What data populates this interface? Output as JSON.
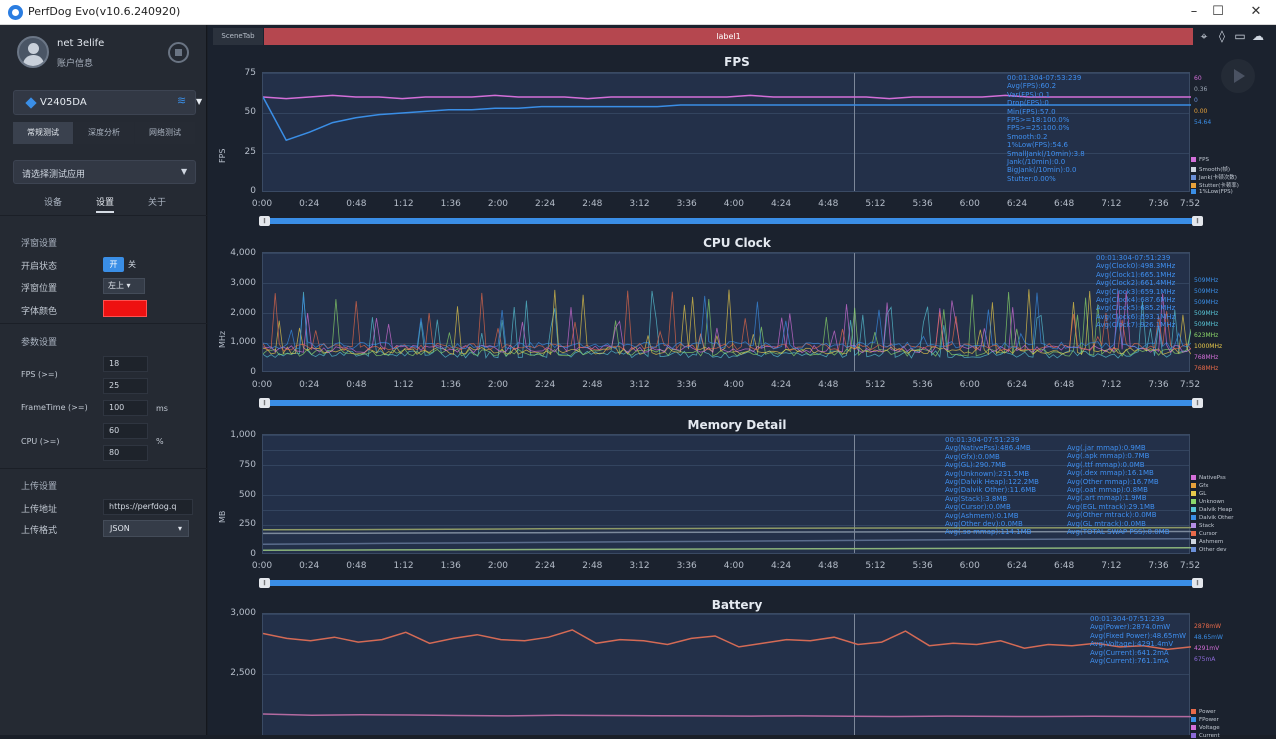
{
  "window": {
    "title": "PerfDog Evo(v10.6.240920)",
    "controls": [
      "–",
      "☐",
      "✕"
    ]
  },
  "sidebar": {
    "user_name": "net 3elife",
    "user_info": "账户信息",
    "device": "V2405DA",
    "mode_tabs": [
      "常规测试",
      "深度分析",
      "网络测试"
    ],
    "app_select_placeholder": "请选择测试应用",
    "sub_tabs": [
      "设备",
      "设置",
      "关于"
    ],
    "float_section": "浮窗设置",
    "float_state_label": "开启状态",
    "float_on": "开",
    "float_off": "关",
    "float_pos_label": "浮窗位置",
    "float_pos_value": "左上",
    "font_color_label": "字体颜色",
    "font_color": "#ee1111",
    "param_section": "参数设置",
    "fps_label": "FPS (>=)",
    "fps_values": [
      "18",
      "25"
    ],
    "frametime_label": "FrameTime (>=)",
    "frametime_value": "100",
    "frametime_unit": "ms",
    "cpu_label": "CPU (>=)",
    "cpu_values": [
      "60",
      "80"
    ],
    "cpu_unit": "%",
    "upload_section": "上传设置",
    "upload_addr_label": "上传地址",
    "upload_addr_value": "https://perfdog.q",
    "upload_fmt_label": "上传格式",
    "upload_fmt_value": "JSON"
  },
  "main": {
    "scene_tab": "SceneTab",
    "label_bar": "label1",
    "x_ticks": [
      "0:00",
      "0:24",
      "0:48",
      "1:12",
      "1:36",
      "2:00",
      "2:24",
      "2:48",
      "3:12",
      "3:36",
      "4:00",
      "4:24",
      "4:48",
      "5:12",
      "5:36",
      "6:00",
      "6:24",
      "6:48",
      "7:12",
      "7:36",
      "7:52"
    ]
  },
  "chart_data": [
    {
      "type": "line",
      "title": "FPS",
      "ylabel": "FPS",
      "ylim": [
        0,
        75
      ],
      "yticks": [
        "75",
        "50",
        "25",
        "0"
      ],
      "cursor_time": "5:00",
      "info": [
        "00:01:304-07:53:239",
        "Avg(FPS):60.2",
        "Var(FPS):0.1",
        "Drop(FPS):0",
        "Min(FPS):57.0",
        "FPS>=18:100.0%",
        "FPS>=25:100.0%",
        "Smooth:0.2",
        "1%Low(FPS):54.6",
        "SmallJank(/10min):3.8",
        "Jank(/10min):0.0",
        "BigJank(/10min):0.0",
        "Stutter:0.00%"
      ],
      "legend": [
        "FPS",
        "Smooth(帧)",
        "Jank(卡顿次数)",
        "Stutter(卡顿率)",
        "1%Low(FPS)"
      ],
      "legend_colors": [
        "#d46fd9",
        "#cfd6e0",
        "#6a8fd8",
        "#e8a23a",
        "#3a8ee6"
      ],
      "right_values": [
        "60",
        "0.36",
        "0",
        "0.00",
        "54.64"
      ],
      "right_colors": [
        "#d46fd9",
        "#9aa5b3",
        "#6a8fd8",
        "#e8a23a",
        "#3a8ee6"
      ],
      "series": [
        {
          "name": "FPS",
          "color": "#d46fd9",
          "values": [
            60,
            59,
            60,
            61,
            60,
            60,
            59,
            60,
            60,
            60,
            61,
            60,
            60,
            60,
            59,
            60,
            60,
            60,
            60,
            60,
            60,
            61,
            60,
            60,
            60,
            60,
            60,
            59,
            60,
            60,
            60,
            60,
            61,
            60,
            60,
            60,
            60,
            60,
            60,
            60,
            60
          ]
        },
        {
          "name": "1%Low(FPS)",
          "color": "#3a8ee6",
          "values": [
            60,
            33,
            38,
            44,
            47,
            49,
            50,
            51,
            52,
            52,
            53,
            53,
            54,
            54,
            54,
            54,
            54,
            54,
            55,
            55,
            55,
            55,
            55,
            55,
            55,
            55,
            55,
            55,
            55,
            55,
            55,
            55,
            55,
            55,
            55,
            55,
            55,
            55,
            55,
            55,
            55
          ]
        }
      ]
    },
    {
      "type": "line",
      "title": "CPU Clock",
      "ylabel": "MHz",
      "ylim": [
        0,
        4000
      ],
      "yticks": [
        "4,000",
        "3,000",
        "2,000",
        "1,000",
        "0"
      ],
      "info": [
        "00:01:304-07:51:239",
        "Avg(Clock0):498.3MHz",
        "Avg(Clock1):665.1MHz",
        "Avg(Clock2):661.4MHz",
        "Avg(Clock3):659.1MHz",
        "Avg(Clock4):687.6MHz",
        "Avg(Clock5):685.2MHz",
        "Avg(Clock6):693.1MHz",
        "Avg(Clock7):926.1MHz"
      ],
      "right_values": [
        "509MHz",
        "509MHz",
        "509MHz",
        "509MHz",
        "509MHz",
        "623MHz",
        "1000MHz",
        "768MHz",
        "768MHz"
      ],
      "right_colors": [
        "#3a8ee6",
        "#3a8ee6",
        "#3a8ee6",
        "#58c4d6",
        "#58c4d6",
        "#8cd76a",
        "#e8c94a",
        "#d46fd9",
        "#e86a4a"
      ]
    },
    {
      "type": "line",
      "title": "Memory Detail",
      "ylabel": "MB",
      "ylim": [
        0,
        1000
      ],
      "yticks": [
        "1,000",
        "750",
        "500",
        "250",
        "0"
      ],
      "info_left": [
        "00:01:304-07:51:239",
        "Avg(NativePss):486.4MB",
        "Avg(Gfx):0.0MB",
        "Avg(GL):290.7MB",
        "Avg(Unknown):231.5MB",
        "Avg(Dalvik Heap):122.2MB",
        "Avg(Dalvik Other):11.6MB",
        "Avg(Stack):3.8MB",
        "Avg(Cursor):0.0MB",
        "Avg(Ashmem):0.1MB",
        "Avg(Other dev):0.0MB",
        "Avg(.so mmap):114.1MB"
      ],
      "info_right": [
        "Avg(.jar mmap):0.9MB",
        "Avg(.apk mmap):0.7MB",
        "Avg(.ttf mmap):0.0MB",
        "Avg(.dex mmap):16.1MB",
        "Avg(Other mmap):16.7MB",
        "Avg(.oat mmap):0.8MB",
        "Avg(.art mmap):1.9MB",
        "Avg(EGL mtrack):29.1MB",
        "Avg(Other mtrack):0.0MB",
        "Avg(GL mtrack):0.0MB",
        "Avg(TOTAL SWAP PSS):0.0MB"
      ],
      "legend": [
        "NativePss",
        "Gfx",
        "GL",
        "Unknown",
        "Dalvik Heap",
        "Dalvik Other",
        "Stack",
        "Cursor",
        "Ashmem",
        "Other dev"
      ],
      "legend_colors": [
        "#d46fd9",
        "#e8a23a",
        "#e8c94a",
        "#8cd76a",
        "#58c4d6",
        "#3a8ee6",
        "#b48de6",
        "#e86a4a",
        "#cfd6e0",
        "#6a8fd8"
      ],
      "series": [
        {
          "name": "NativePss",
          "color": "#8e9a66",
          "values": [
            210,
            212,
            215,
            218,
            220,
            222,
            224,
            225,
            226,
            227,
            228
          ]
        },
        {
          "name": "GL",
          "color": "#7c8a9c",
          "values": [
            180,
            182,
            184,
            186,
            188,
            190,
            192,
            193,
            194,
            195,
            196
          ]
        },
        {
          "name": "Unknown",
          "color": "#5a6c8c",
          "values": [
            90,
            95,
            100,
            105,
            110,
            115,
            120,
            125,
            130,
            133,
            135
          ]
        },
        {
          "name": "Dalvik Heap",
          "color": "#8bb37a",
          "values": [
            40,
            42,
            44,
            46,
            48,
            50,
            52,
            54,
            56,
            58,
            60
          ]
        }
      ]
    },
    {
      "type": "line",
      "title": "Battery",
      "ylim": [
        2000,
        3000
      ],
      "yticks": [
        "3,000",
        "2,500"
      ],
      "info": [
        "00:01:304-07:51:239",
        "Avg(Power):2874.0mW",
        "Avg(Fixed Power):48.65mW",
        "Avg(Voltage):4291.4mV",
        "Avg(Current):641.2mA",
        "Avg(Current):761.1mA"
      ],
      "legend": [
        "Power",
        "FPower",
        "Voltage",
        "Current"
      ],
      "legend_colors": [
        "#e86a4a",
        "#3a8ee6",
        "#d46fd9",
        "#8c6ad8"
      ],
      "right_values": [
        "2878mW",
        "48.65mW",
        "4291mV",
        "675mA"
      ],
      "right_colors": [
        "#e86a4a",
        "#3a8ee6",
        "#d46fd9",
        "#8c6ad8"
      ],
      "series": [
        {
          "name": "Power",
          "color": "#d46a55",
          "values": [
            2840,
            2800,
            2780,
            2810,
            2770,
            2790,
            2850,
            2760,
            2800,
            2830,
            2790,
            2780,
            2810,
            2870,
            2760,
            2790,
            2780,
            2750,
            2800,
            2820,
            2730,
            2760,
            2790,
            2780,
            2810,
            2750,
            2770,
            2860,
            2740,
            2760,
            2750,
            2780,
            2720,
            2750,
            2740,
            2760,
            2730,
            2740,
            2710,
            2730
          ]
        },
        {
          "name": "Current",
          "color": "#b46aa0",
          "values": [
            2180,
            2170,
            2175,
            2172,
            2168,
            2165,
            2170,
            2168,
            2166,
            2165,
            2163,
            2165,
            2162,
            2160,
            2163,
            2161,
            2160,
            2162,
            2160,
            2159
          ]
        }
      ]
    }
  ]
}
